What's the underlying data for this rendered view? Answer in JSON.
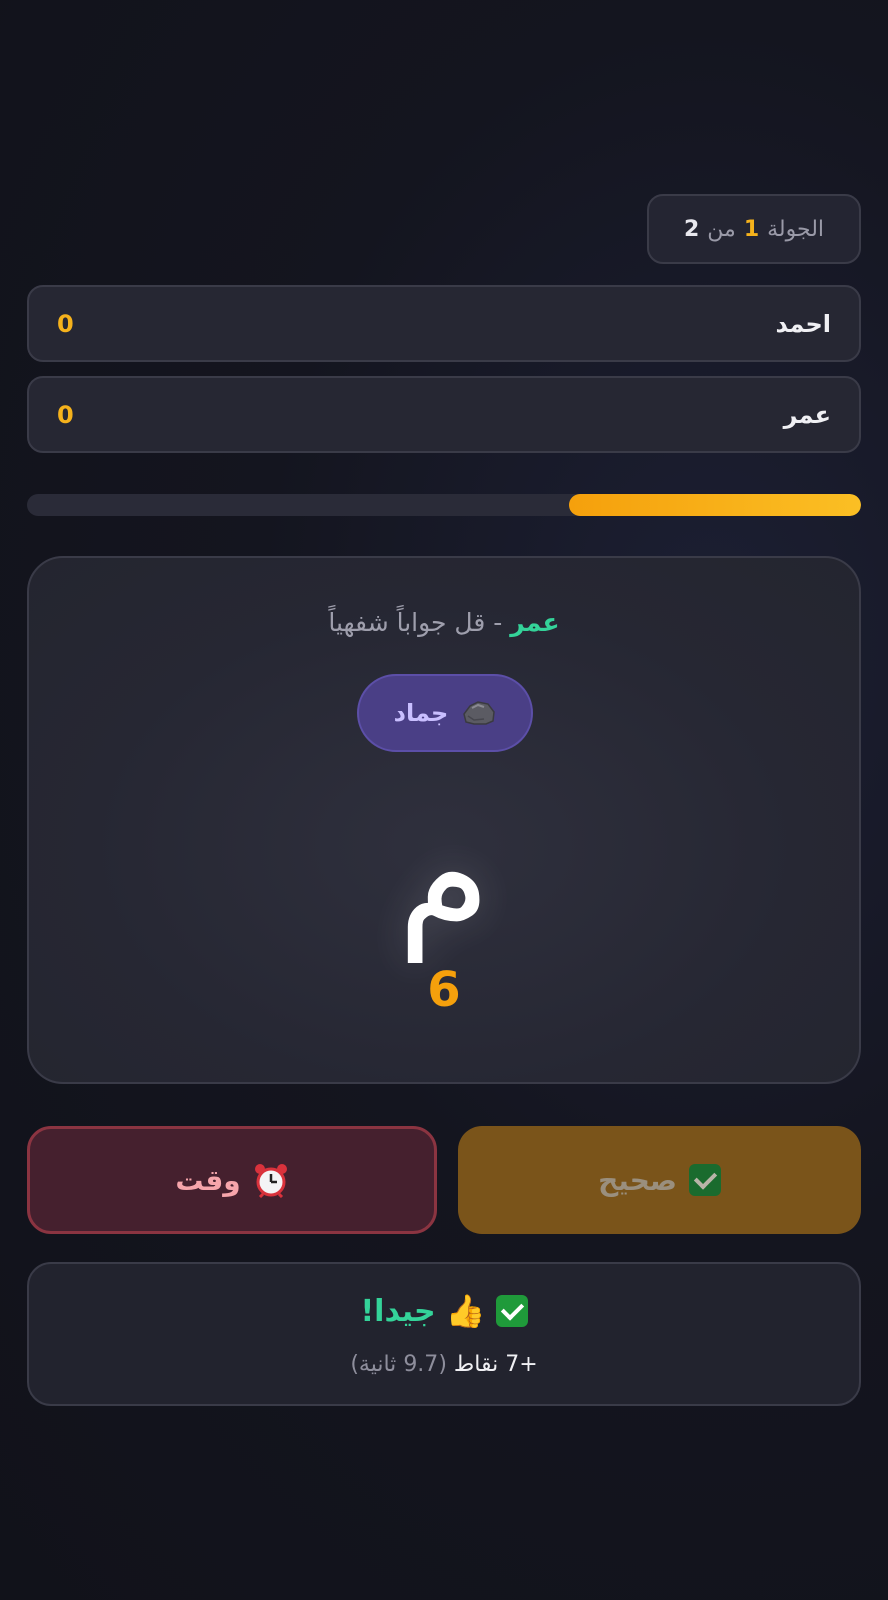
{
  "round": {
    "label": "الجولة",
    "current": "1",
    "of": "من",
    "total": "2"
  },
  "players": [
    {
      "name": "احمد",
      "score": "0"
    },
    {
      "name": "عمر",
      "score": "0"
    }
  ],
  "timer": {
    "remaining_fraction": 0.35,
    "color": "#f5a00c"
  },
  "turn": {
    "player": "عمر",
    "instruction": "- قل جواباً شفهياً"
  },
  "category": {
    "icon": "rock-icon",
    "label": "جماد"
  },
  "letter": "م",
  "countdown": "6",
  "buttons": {
    "correct": {
      "icon": "check-icon",
      "label": "صحيح"
    },
    "time": {
      "icon": "alarm-clock-icon",
      "label": "وقت"
    }
  },
  "feedback": {
    "icons": [
      "check-icon",
      "thumbs-up-icon"
    ],
    "title": "جيدا!",
    "points": "+7 نقاط",
    "time": "(9.7 ثانية)"
  },
  "colors": {
    "accent": "#f5b21c",
    "success": "#34d399",
    "danger": "#8b3441",
    "category": "#4a3f86"
  }
}
